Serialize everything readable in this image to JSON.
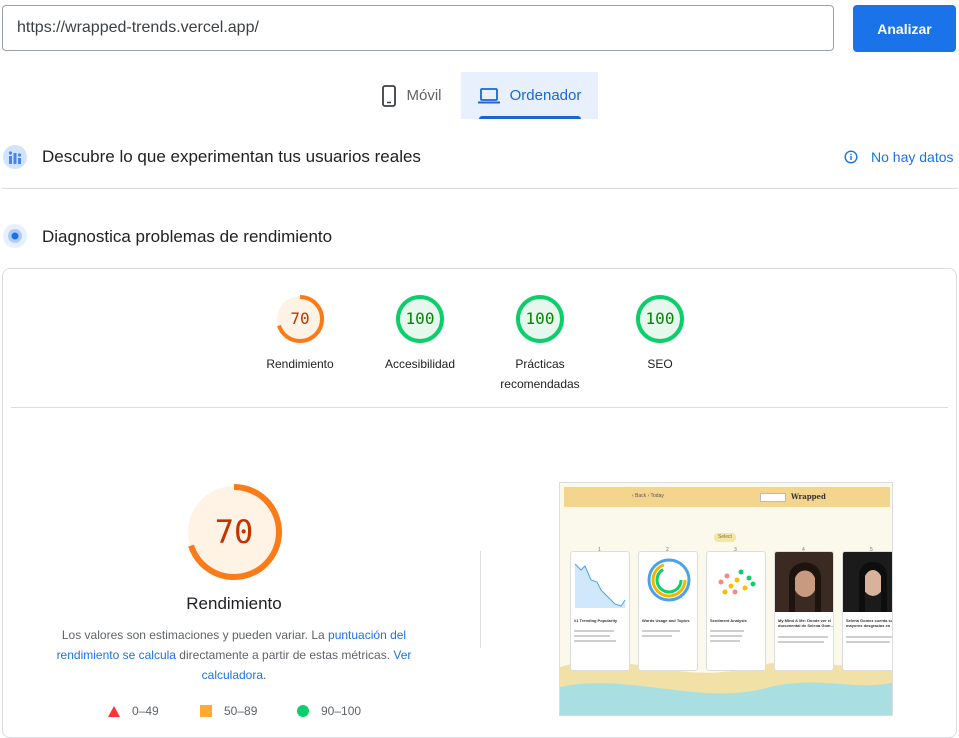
{
  "search": {
    "url_value": "https://wrapped-trends.vercel.app/",
    "analyze_label": "Analizar"
  },
  "tabs": [
    {
      "label": "Móvil",
      "icon": "phone-icon",
      "selected": false
    },
    {
      "label": "Ordenador",
      "icon": "laptop-icon",
      "selected": true
    }
  ],
  "field_data": {
    "title": "Descubre lo que experimentan tus usuarios reales",
    "status": "No hay datos",
    "status_icon": "info-icon"
  },
  "lab_data": {
    "title": "Diagnostica problemas de rendimiento"
  },
  "scores": [
    {
      "label": "Rendimiento",
      "value": "70",
      "fraction": 0.7,
      "color": "#fa7b17"
    },
    {
      "label": "Accesibilidad",
      "value": "100",
      "fraction": 1.0,
      "color": "#0cce6b"
    },
    {
      "label": "Prácticas recomendadas",
      "value": "100",
      "fraction": 1.0,
      "color": "#0cce6b"
    },
    {
      "label": "SEO",
      "value": "100",
      "fraction": 1.0,
      "color": "#0cce6b"
    }
  ],
  "main_score": {
    "value": "70",
    "fraction": 0.7,
    "label": "Rendimiento",
    "desc_1": "Los valores son estimaciones y pueden variar. La ",
    "link_1": "puntuación del rendimiento se calcula",
    "desc_2": " directamente a partir de estas métricas. ",
    "link_2": "Ver calculadora",
    "desc_3": "."
  },
  "legend": [
    {
      "range": "0–49",
      "shape": "triangle",
      "color": "#ff3333"
    },
    {
      "range": "50–89",
      "shape": "square",
      "color": "#ffaa33"
    },
    {
      "range": "90–100",
      "shape": "circle",
      "color": "#0cce6b"
    }
  ],
  "thumbnail": {
    "nav_text": "‹ Back   › Today",
    "brand": "Wrapped",
    "badge": "Select",
    "card_numbers": [
      "1",
      "2",
      "3",
      "4",
      "5"
    ],
    "card_titles": [
      "#1 Trending Popularity",
      "Words Usage and Topics",
      "Sentiment Analysis",
      "My Mind & Me: Donde ver el documental de Selena Gom...",
      "Selena Gomez cuenta sus mayores desgracias en"
    ]
  }
}
